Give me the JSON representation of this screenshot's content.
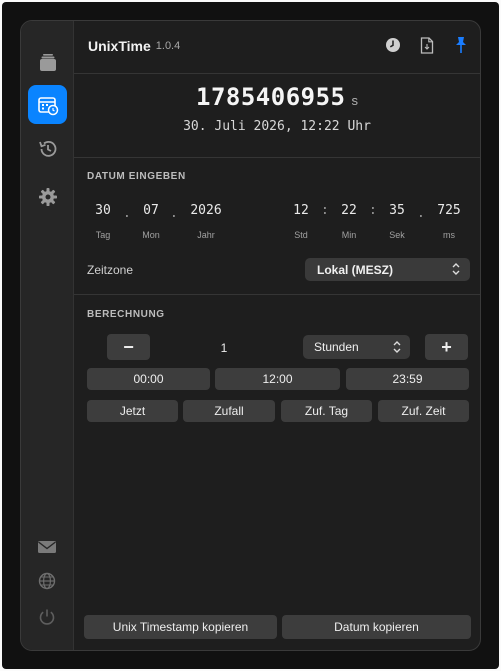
{
  "app": {
    "title": "UnixTime",
    "version": "1.0.4"
  },
  "sidebar": {
    "items": [
      {
        "name": "stack-icon",
        "active": false
      },
      {
        "name": "calendar-clock-icon",
        "active": true
      },
      {
        "name": "history-icon",
        "active": false
      },
      {
        "name": "gear-icon",
        "active": false
      }
    ],
    "bottom": [
      "mail-icon",
      "globe-icon",
      "power-icon"
    ]
  },
  "header_icons": [
    "clock-icon",
    "document-icon",
    "pin-icon"
  ],
  "timestamp": {
    "value": "1785406955",
    "unit": "s",
    "date": "30. Juli 2026, 12:22 Uhr"
  },
  "date_input": {
    "section_label": "DATUM EINGEBEN",
    "day": {
      "value": "30",
      "caption": "Tag"
    },
    "month": {
      "value": "07",
      "caption": "Mon"
    },
    "year": {
      "value": "2026",
      "caption": "Jahr"
    },
    "hour": {
      "value": "12",
      "caption": "Std"
    },
    "minute": {
      "value": "22",
      "caption": "Min"
    },
    "second": {
      "value": "35",
      "caption": "Sek"
    },
    "ms": {
      "value": "725",
      "caption": "ms"
    },
    "sep_dot": ".",
    "sep_colon": ":"
  },
  "timezone": {
    "label": "Zeitzone",
    "selected": "Lokal (MESZ)"
  },
  "calculation": {
    "section_label": "BERECHNUNG",
    "minus_label": "−",
    "plus_label": "+",
    "amount": "1",
    "unit_selected": "Stunden",
    "time_presets": [
      "00:00",
      "12:00",
      "23:59"
    ],
    "actions": [
      "Jetzt",
      "Zufall",
      "Zuf. Tag",
      "Zuf. Zeit"
    ]
  },
  "footer": {
    "copy_unix_label": "Unix Timestamp kopieren",
    "copy_date_label": "Datum kopieren"
  },
  "colors": {
    "accent": "#0a84ff",
    "background": "#1e1e1e",
    "button": "#3d3d3d"
  }
}
